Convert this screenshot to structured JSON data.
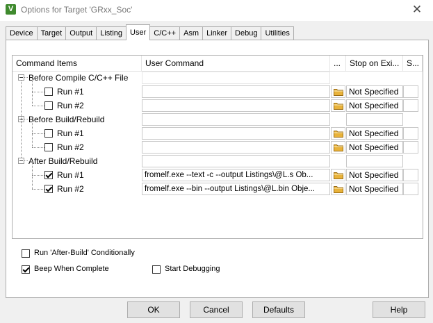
{
  "window": {
    "title": "Options for Target 'GRxx_Soc'",
    "app_icon_text": "V",
    "close_glyph": "✕"
  },
  "tabs": [
    {
      "label": "Device",
      "active": false
    },
    {
      "label": "Target",
      "active": false
    },
    {
      "label": "Output",
      "active": false
    },
    {
      "label": "Listing",
      "active": false
    },
    {
      "label": "User",
      "active": true
    },
    {
      "label": "C/C++",
      "active": false
    },
    {
      "label": "Asm",
      "active": false
    },
    {
      "label": "Linker",
      "active": false
    },
    {
      "label": "Debug",
      "active": false
    },
    {
      "label": "Utilities",
      "active": false
    }
  ],
  "grid": {
    "headers": [
      "Command Items",
      "User Command",
      "...",
      "Stop on Exi...",
      "S..."
    ],
    "groups": [
      {
        "label": "Before Compile C/C++ File",
        "has_fields": false,
        "runs": [
          {
            "label": "Run #1",
            "checked": false,
            "command": "",
            "stop": "Not Specified"
          },
          {
            "label": "Run #2",
            "checked": false,
            "command": "",
            "stop": "Not Specified"
          }
        ]
      },
      {
        "label": "Before Build/Rebuild",
        "has_fields": true,
        "runs": [
          {
            "label": "Run #1",
            "checked": false,
            "command": "",
            "stop": "Not Specified"
          },
          {
            "label": "Run #2",
            "checked": false,
            "command": "",
            "stop": "Not Specified"
          }
        ]
      },
      {
        "label": "After Build/Rebuild",
        "has_fields": true,
        "runs": [
          {
            "label": "Run #1",
            "checked": true,
            "command": "fromelf.exe --text -c --output Listings\\@L.s  Ob...",
            "stop": "Not Specified"
          },
          {
            "label": "Run #2",
            "checked": true,
            "command": "fromelf.exe --bin --output Listings\\@L.bin Obje...",
            "stop": "Not Specified"
          }
        ]
      }
    ]
  },
  "options": {
    "run_after_build": {
      "label": "Run 'After-Build' Conditionally",
      "checked": false
    },
    "beep": {
      "label": "Beep When Complete",
      "checked": true
    },
    "start_debugging": {
      "label": "Start Debugging",
      "checked": false
    }
  },
  "buttons": {
    "ok": "OK",
    "cancel": "Cancel",
    "defaults": "Defaults",
    "help": "Help"
  },
  "colors": {
    "folder": "#e8b23a",
    "app_icon": "#3f8a2e"
  }
}
